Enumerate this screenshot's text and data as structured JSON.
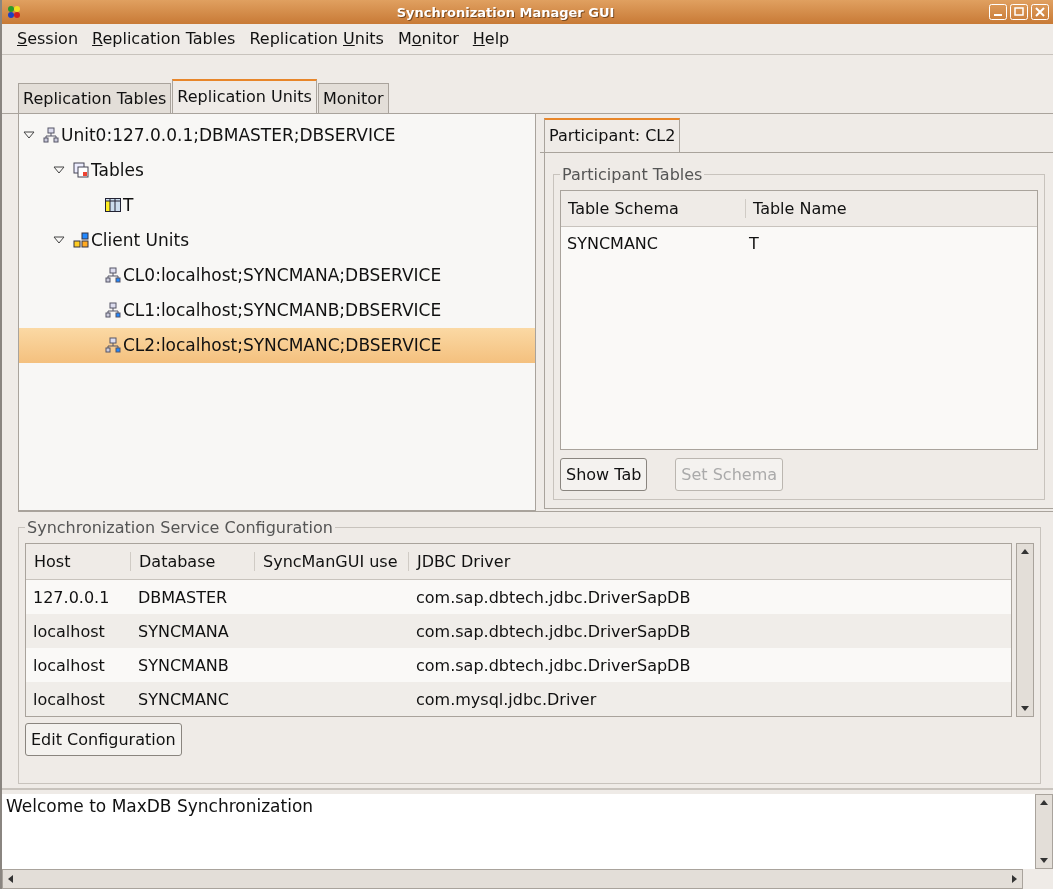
{
  "window": {
    "title": "Synchronization Manager GUI"
  },
  "menu": [
    {
      "parts": [
        {
          "text": "S",
          "underlined": true
        },
        {
          "text": "ession",
          "underlined": false
        }
      ]
    },
    {
      "parts": [
        {
          "text": "R",
          "underlined": true
        },
        {
          "text": "eplication Tables",
          "underlined": false
        }
      ]
    },
    {
      "parts": [
        {
          "text": "Replication ",
          "underlined": false
        },
        {
          "text": "U",
          "underlined": true
        },
        {
          "text": "nits",
          "underlined": false
        }
      ]
    },
    {
      "parts": [
        {
          "text": "M",
          "underlined": false
        },
        {
          "text": "o",
          "underlined": true
        },
        {
          "text": "nitor",
          "underlined": false
        }
      ]
    },
    {
      "parts": [
        {
          "text": "H",
          "underlined": true
        },
        {
          "text": "elp",
          "underlined": false
        }
      ]
    }
  ],
  "tabs": [
    {
      "label": "Replication Tables",
      "selected": false
    },
    {
      "label": "Replication Units",
      "selected": true
    },
    {
      "label": "Monitor",
      "selected": false
    }
  ],
  "tree": [
    {
      "kind": "unit",
      "label": "Unit0:127.0.0.1;DBMASTER;DBSERVICE",
      "expanded": true,
      "selected": false,
      "children": [
        {
          "kind": "tables",
          "label": "Tables",
          "expanded": true,
          "selected": false,
          "children": [
            {
              "kind": "table",
              "label": "T",
              "selected": false
            }
          ]
        },
        {
          "kind": "clients",
          "label": "Client Units",
          "expanded": true,
          "selected": false,
          "children": [
            {
              "kind": "client",
              "label": "CL0:localhost;SYNCMANA;DBSERVICE",
              "selected": false
            },
            {
              "kind": "client",
              "label": "CL1:localhost;SYNCMANB;DBSERVICE",
              "selected": false
            },
            {
              "kind": "client",
              "label": "CL2:localhost;SYNCMANC;DBSERVICE",
              "selected": true
            }
          ]
        }
      ]
    }
  ],
  "participant": {
    "tab": {
      "label": "Participant: CL2",
      "selected": true
    },
    "group_title": "Participant Tables",
    "columns": [
      "Table Schema",
      "Table Name"
    ],
    "rows": [
      [
        "SYNCMANC",
        "T"
      ]
    ],
    "buttons": [
      {
        "label": "Show Tab",
        "disabled": false
      },
      {
        "label": "Set Schema",
        "disabled": true
      }
    ]
  },
  "config": {
    "group_title": "Synchronization Service Configuration",
    "columns": [
      "Host",
      "Database",
      "SyncManGUI use",
      "JDBC Driver"
    ],
    "rows": [
      [
        "127.0.0.1",
        "DBMASTER",
        "",
        "com.sap.dbtech.jdbc.DriverSapDB"
      ],
      [
        "localhost",
        "SYNCMANA",
        "",
        "com.sap.dbtech.jdbc.DriverSapDB"
      ],
      [
        "localhost",
        "SYNCMANB",
        "",
        "com.sap.dbtech.jdbc.DriverSapDB"
      ],
      [
        "localhost",
        "SYNCMANC",
        "",
        "com.mysql.jdbc.Driver"
      ]
    ],
    "button": "Edit Configuration"
  },
  "log": {
    "text": "Welcome to MaxDB Synchronization"
  }
}
